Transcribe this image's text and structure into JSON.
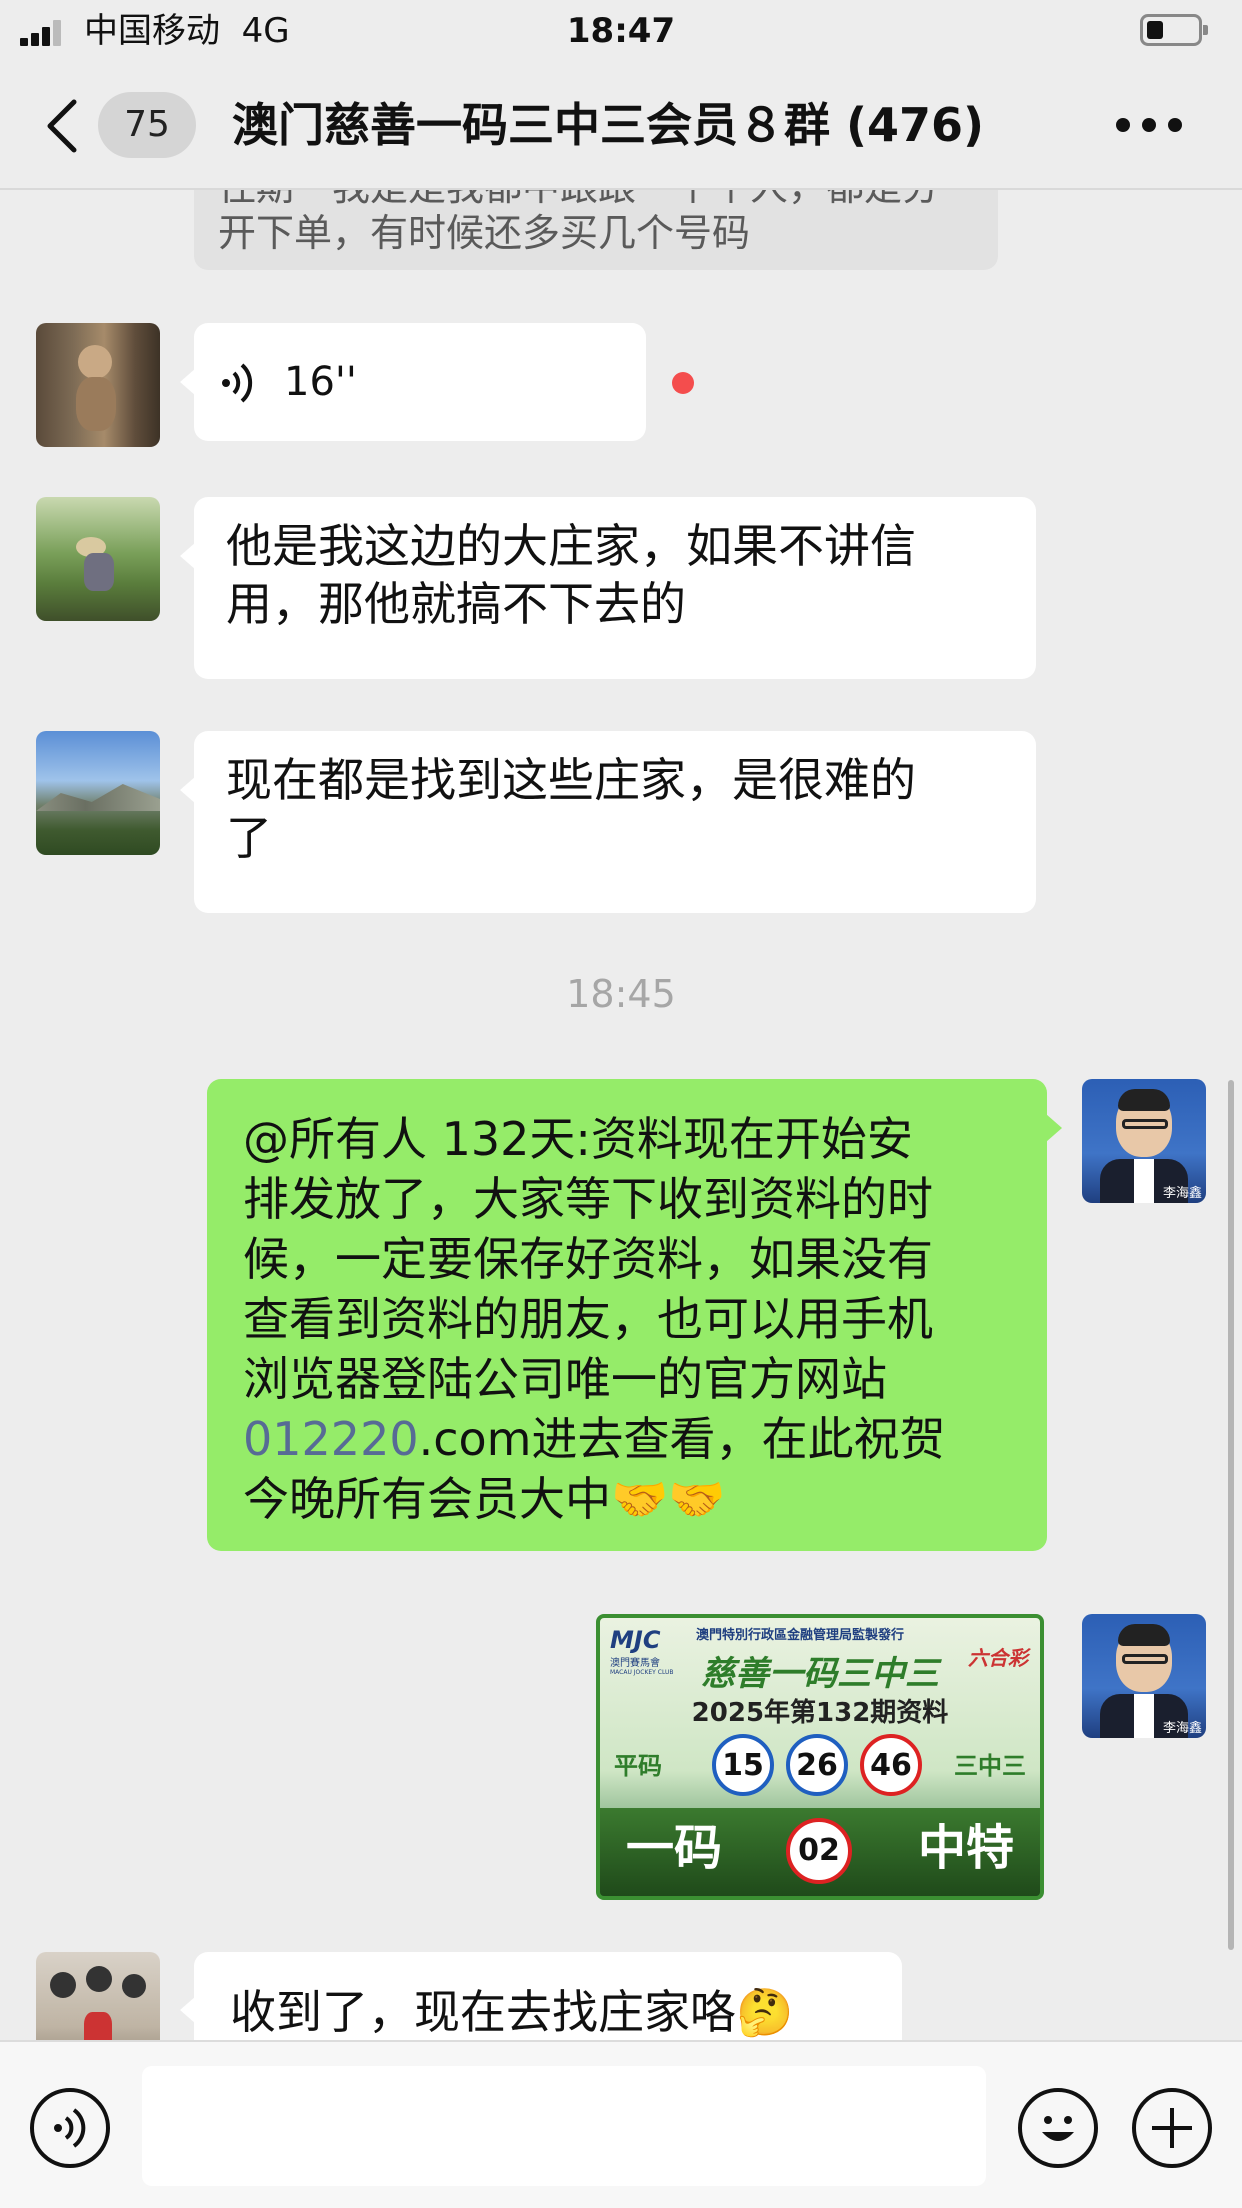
{
  "status_bar": {
    "carrier": "中国移动",
    "network": "4G",
    "time": "18:47"
  },
  "nav": {
    "unread_count": "75",
    "title": "澳门慈善一码三中三会员８群 (476)"
  },
  "messages": {
    "quoted_line1": "往期一我是是我都中跟跟一个个人，都是分",
    "quoted_line2": "开下单，有时候还多买几个号码",
    "voice_duration": "16''",
    "msg2_line1": "他是我这边的大庄家，如果不讲信",
    "msg2_line2": "用，那他就搞不下去的",
    "msg3_line1": "现在都是找到这些庄家，是很难的",
    "msg3_line2": "了",
    "timestamp": "18:45",
    "sent_line1": "@所有人 132天:资料现在开始安",
    "sent_line2": "排发放了，大家等下收到资料的时",
    "sent_line3": "候，一定要保存好资料，如果没有",
    "sent_line4": "查看到资料的朋友，也可以用手机",
    "sent_line5": "浏览器登陆公司唯一的官方网站",
    "sent_link": "012220",
    "sent_line6_rest": ".com进去查看，在此祝贺",
    "sent_line7": "今晚所有会员大中🤝🤝",
    "sender_name": "李海鑫",
    "last_msg": "收到了，现在去找庄家咯🤔"
  },
  "poster": {
    "top_text": "澳門特別行政區金融管理局監製發行",
    "club_name": "澳門賽馬會",
    "club_en": "MACAU JOCKEY CLUB",
    "brand": "六合彩",
    "title": "慈善一码三中三",
    "subtitle": "2025年第132期资料",
    "left_label": "平码",
    "right_label": "三中三",
    "numbers": [
      "15",
      "26",
      "46"
    ],
    "bottom_left": "一码",
    "special_number": "02",
    "bottom_right": "中特"
  },
  "colors": {
    "sent_bubble": "#95ec69",
    "received_bubble": "#ffffff",
    "background": "#ededed",
    "link": "#576b95",
    "unread_dot": "#f44d4d"
  },
  "icons": [
    "back-chevron-icon",
    "more-icon",
    "voice-wave-icon",
    "voice-input-icon",
    "emoji-icon",
    "plus-icon"
  ]
}
